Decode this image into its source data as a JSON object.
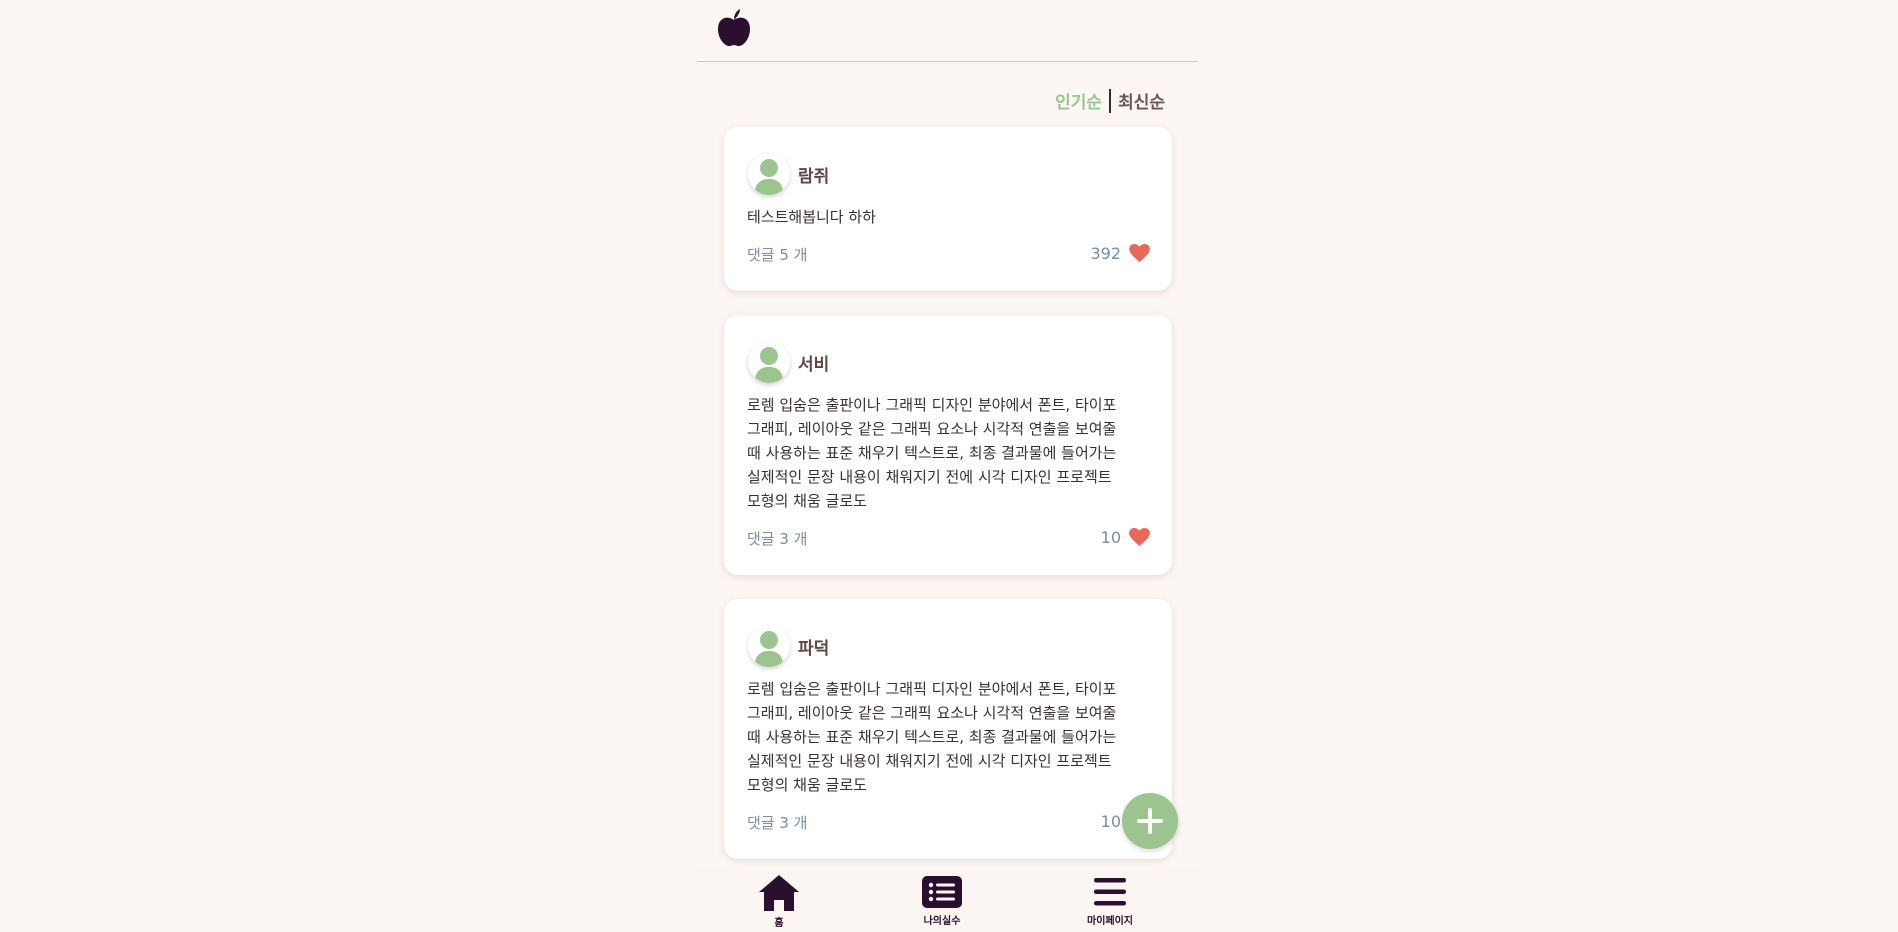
{
  "header": {
    "logo_icon": "apple-icon"
  },
  "sort": {
    "popular": "인기순",
    "latest": "최신순"
  },
  "posts": [
    {
      "author": "람쥐",
      "content": "테스트해봅니다 하하",
      "comments": "댓글 5 개",
      "likes": "392"
    },
    {
      "author": "서비",
      "content": "로렘 입숨은 출판이나 그래픽 디자인 분야에서 폰트, 타이포그래피, 레이아웃 같은 그래픽 요소나 시각적 연출을 보여줄 때 사용하는 표준 채우기 텍스트로, 최종 결과물에 들어가는 실제적인 문장 내용이 채워지기 전에 시각 디자인 프로젝트 모형의 채움 글로도",
      "comments": "댓글 3 개",
      "likes": "10"
    },
    {
      "author": "파덕",
      "content": "로렘 입숨은 출판이나 그래픽 디자인 분야에서 폰트, 타이포그래피, 레이아웃 같은 그래픽 요소나 시각적 연출을 보여줄 때 사용하는 표준 채우기 텍스트로, 최종 결과물에 들어가는 실제적인 문장 내용이 채워지기 전에 시각 디자인 프로젝트 모형의 채움 글로도",
      "comments": "댓글 3 개",
      "likes": "10"
    }
  ],
  "fab": {
    "icon": "plus-icon"
  },
  "nav": {
    "home": "홈",
    "my_mistakes": "나의실수",
    "my_page": "마이페이지"
  },
  "colors": {
    "accent": "#9cc48f",
    "heart": "#e8685a",
    "nav_icon": "#2b0f2e",
    "background": "#fdf7f3"
  }
}
